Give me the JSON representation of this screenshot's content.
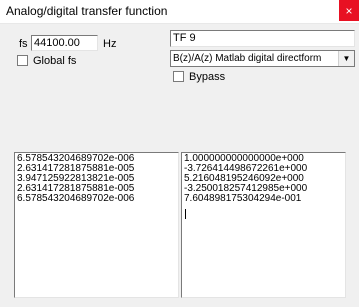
{
  "window": {
    "title": "Analog/digital transfer function",
    "close_glyph": "×"
  },
  "sampling": {
    "fs_label": "fs",
    "fs_value": "44100.00",
    "unit": "Hz",
    "global_fs_label": "Global fs",
    "global_fs_checked": false
  },
  "filter": {
    "name": "TF 9",
    "mode_selected": "B(z)/A(z) Matlab digital directform",
    "bypass_label": "Bypass",
    "bypass_checked": false
  },
  "coefficients": {
    "b": [
      "6.578543204689702e-006",
      "2.631417281875881e-005",
      "3.947125922813821e-005",
      "2.631417281875881e-005",
      "6.578543204689702e-006"
    ],
    "a": [
      "1.000000000000000e+000",
      "-3.726414498672261e+000",
      "5.216048195246092e+000",
      "-3.250018257412985e+000",
      "7.604898175304294e-001"
    ]
  },
  "icons": {
    "close": "close-icon",
    "dropdown": "chevron-down-icon"
  },
  "colors": {
    "close_button": "#e81123",
    "window_bg": "#f0f0f0"
  }
}
